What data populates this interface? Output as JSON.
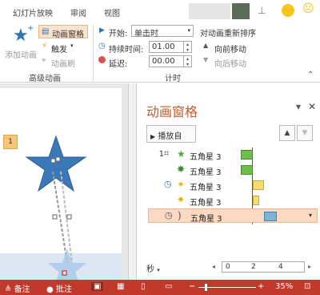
{
  "tabs": [
    "幻灯片放映",
    "审阅",
    "视图"
  ],
  "ribbon": {
    "add_animation": "添加动画",
    "animation_pane": "动画窗格",
    "trigger": "触发",
    "animation_painter": "动画刷",
    "group_advanced": "高级动画",
    "start_label": "开始:",
    "start_value": "单击时",
    "duration_label": "持续时间:",
    "duration_value": "01.00",
    "delay_label": "延迟:",
    "delay_value": "00.00",
    "group_timing": "计时",
    "reorder_title": "对动画重新排序",
    "move_earlier": "向前移动",
    "move_later": "向后移动"
  },
  "slide": {
    "tag": "1"
  },
  "pane": {
    "title": "动画窗格",
    "play_label": "播放自",
    "rows": [
      {
        "num": "1",
        "name": "五角星 3"
      },
      {
        "num": "",
        "name": "五角星 3"
      },
      {
        "num": "",
        "name": "五角星 3"
      },
      {
        "num": "",
        "name": "五角星 3"
      },
      {
        "num": "",
        "name": "五角星 3"
      }
    ],
    "seconds_label": "秒",
    "ruler": [
      "0",
      "2",
      "4"
    ]
  },
  "status": {
    "notes": "备注",
    "comments": "批注",
    "zoom": "35%"
  },
  "colors": {
    "accent": "#c55a2b",
    "status_bar": "#c0392b",
    "bar_green": "#6cc04a",
    "bar_yellow": "#f7dc6f",
    "bar_blue": "#7fb3d5"
  }
}
